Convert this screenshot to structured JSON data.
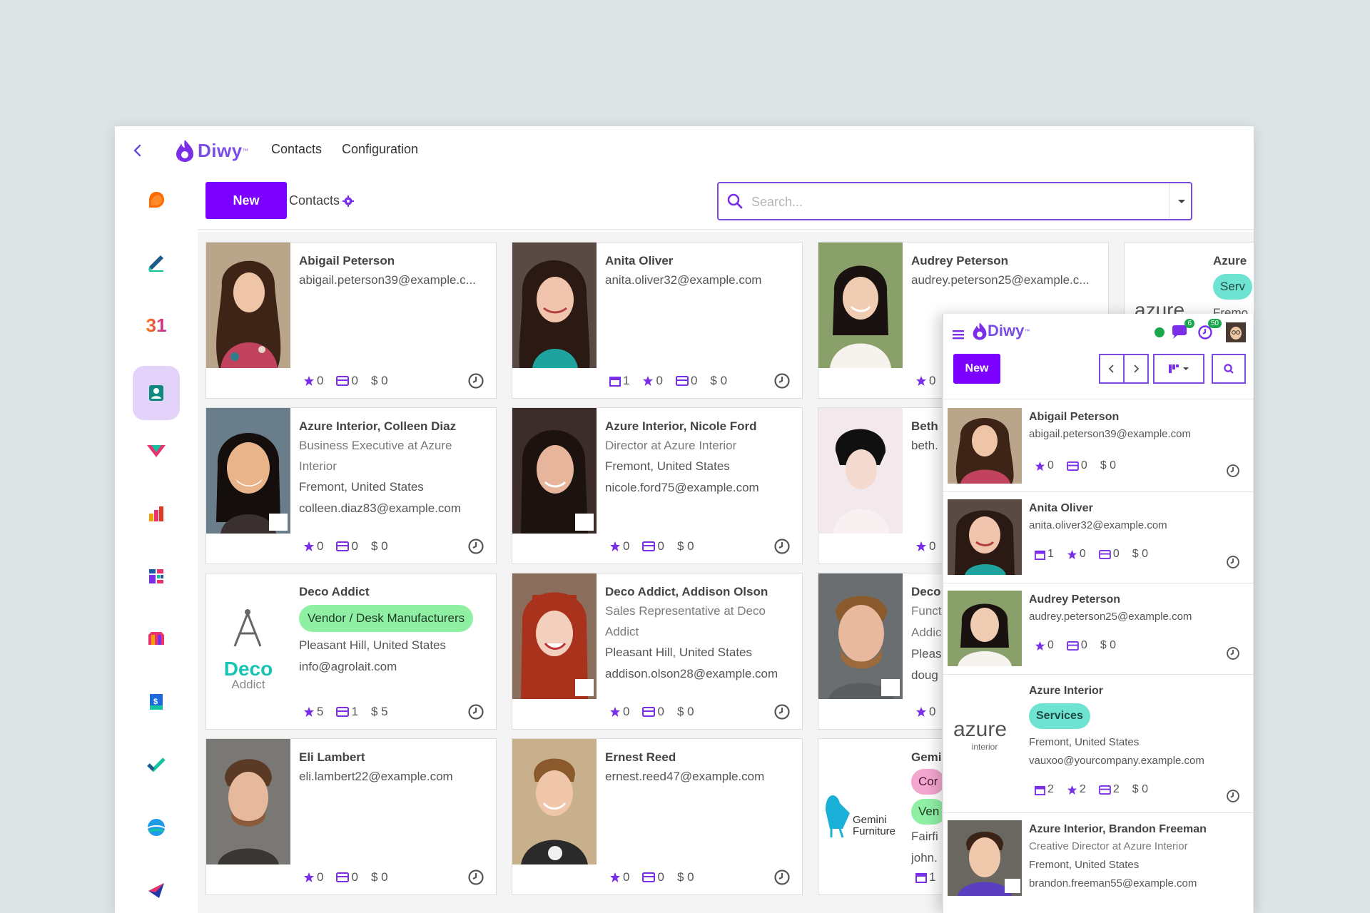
{
  "app": {
    "logo_text": "Diwy",
    "logo_tm": "™",
    "nav": [
      "Contacts",
      "Configuration"
    ]
  },
  "sidebar": {
    "items": [
      {
        "icon": "discuss-icon"
      },
      {
        "icon": "sign-icon"
      },
      {
        "icon": "calendar-icon",
        "label": "31"
      },
      {
        "icon": "contacts-icon",
        "active": true
      },
      {
        "icon": "crm-icon"
      },
      {
        "icon": "sales-icon"
      },
      {
        "icon": "dashboard-icon"
      },
      {
        "icon": "point-of-sale-icon"
      },
      {
        "icon": "invoicing-icon"
      },
      {
        "icon": "project-icon"
      },
      {
        "icon": "website-icon"
      },
      {
        "icon": "email-marketing-icon"
      }
    ]
  },
  "toolbar": {
    "new_label": "New",
    "breadcrumb": "Contacts",
    "search_placeholder": "Search..."
  },
  "cards": [
    {
      "name": "Abigail Peterson",
      "lines": [
        "abigail.peterson39@example.c..."
      ],
      "stats": {
        "stars": "0",
        "cards": "0",
        "money": "$ 0"
      }
    },
    {
      "name": "Anita Oliver",
      "lines": [
        "anita.oliver32@example.com"
      ],
      "stats": {
        "cal": "1",
        "stars": "0",
        "cards": "0",
        "money": "$ 0"
      }
    },
    {
      "name": "Audrey Peterson",
      "lines": [
        "audrey.peterson25@example.c..."
      ],
      "stats": {
        "stars": "0"
      }
    },
    {
      "name": "Azure",
      "tag": "Serv",
      "lines": [
        "Fremo"
      ]
    },
    {
      "name": "Azure Interior, Colleen Diaz",
      "muted": "Business Executive at Azure Interior",
      "lines": [
        "Fremont, United States",
        "colleen.diaz83@example.com"
      ],
      "stats": {
        "stars": "0",
        "cards": "0",
        "money": "$ 0"
      }
    },
    {
      "name": "Azure Interior, Nicole Ford",
      "muted": "Director at Azure Interior",
      "lines": [
        "Fremont, United States",
        "nicole.ford75@example.com"
      ],
      "stats": {
        "stars": "0",
        "cards": "0",
        "money": "$ 0"
      }
    },
    {
      "name": "Beth",
      "lines": [
        "beth."
      ],
      "stats": {
        "stars": "0"
      }
    },
    {
      "name": "Deco Addict",
      "tag": "Vendor / Desk Manufacturers",
      "lines": [
        "Pleasant Hill, United States",
        "info@agrolait.com"
      ],
      "stats": {
        "stars": "5",
        "cards": "1",
        "money": "$ 5"
      },
      "logo_top": "Deco",
      "logo_bottom": "Addict"
    },
    {
      "name": "Deco Addict, Addison Olson",
      "muted": "Sales Representative at Deco Addict",
      "lines": [
        "Pleasant Hill, United States",
        "addison.olson28@example.com"
      ],
      "stats": {
        "stars": "0",
        "cards": "0",
        "money": "$ 0"
      }
    },
    {
      "name": "Deco",
      "lines": [
        "Funct",
        "Addic",
        "Pleas",
        "doug"
      ],
      "stats": {
        "stars": "0"
      }
    },
    {
      "name": "Eli Lambert",
      "lines": [
        "eli.lambert22@example.com"
      ],
      "stats": {
        "stars": "0",
        "cards": "0",
        "money": "$ 0"
      }
    },
    {
      "name": "Ernest Reed",
      "lines": [
        "ernest.reed47@example.com"
      ],
      "stats": {
        "stars": "0",
        "cards": "0",
        "money": "$ 0"
      }
    },
    {
      "name": "Gemi",
      "tags": [
        "Cor",
        "Ven"
      ],
      "lines": [
        "Fairfi",
        "john."
      ],
      "stats": {
        "cal": "1"
      },
      "logo_top": "Gemini",
      "logo_bottom": "Furniture"
    }
  ],
  "mobile": {
    "logo_text": "Diwy",
    "logo_tm": "™",
    "new_label": "New",
    "badges": {
      "messages": "6",
      "activities": "50"
    },
    "cards": [
      {
        "name": "Abigail Peterson",
        "lines": [
          "abigail.peterson39@example.com"
        ],
        "stats": {
          "stars": "0",
          "cards": "0",
          "money": "$ 0"
        }
      },
      {
        "name": "Anita Oliver",
        "lines": [
          "anita.oliver32@example.com"
        ],
        "stats": {
          "cal": "1",
          "stars": "0",
          "cards": "0",
          "money": "$ 0"
        }
      },
      {
        "name": "Audrey Peterson",
        "lines": [
          "audrey.peterson25@example.com"
        ],
        "stats": {
          "stars": "0",
          "cards": "0",
          "money": "$ 0"
        }
      },
      {
        "name": "Azure Interior",
        "tag": "Services",
        "lines": [
          "Fremont, United States",
          "vauxoo@yourcompany.example.com"
        ],
        "stats": {
          "cal": "2",
          "stars": "2",
          "cards": "2",
          "money": "$ 0"
        },
        "logo_top": "azure",
        "logo_bottom": "interior"
      },
      {
        "name": "Azure Interior, Brandon Freeman",
        "muted": "Creative Director at Azure Interior",
        "lines": [
          "Fremont, United States",
          "brandon.freeman55@example.com"
        ]
      }
    ]
  },
  "colors": {
    "accent": "#7b00ff",
    "tag_green": "#8ff0a4",
    "tag_teal": "#6fe3d2",
    "tag_pink": "#f3a6cf",
    "background": "#dde4e5"
  }
}
